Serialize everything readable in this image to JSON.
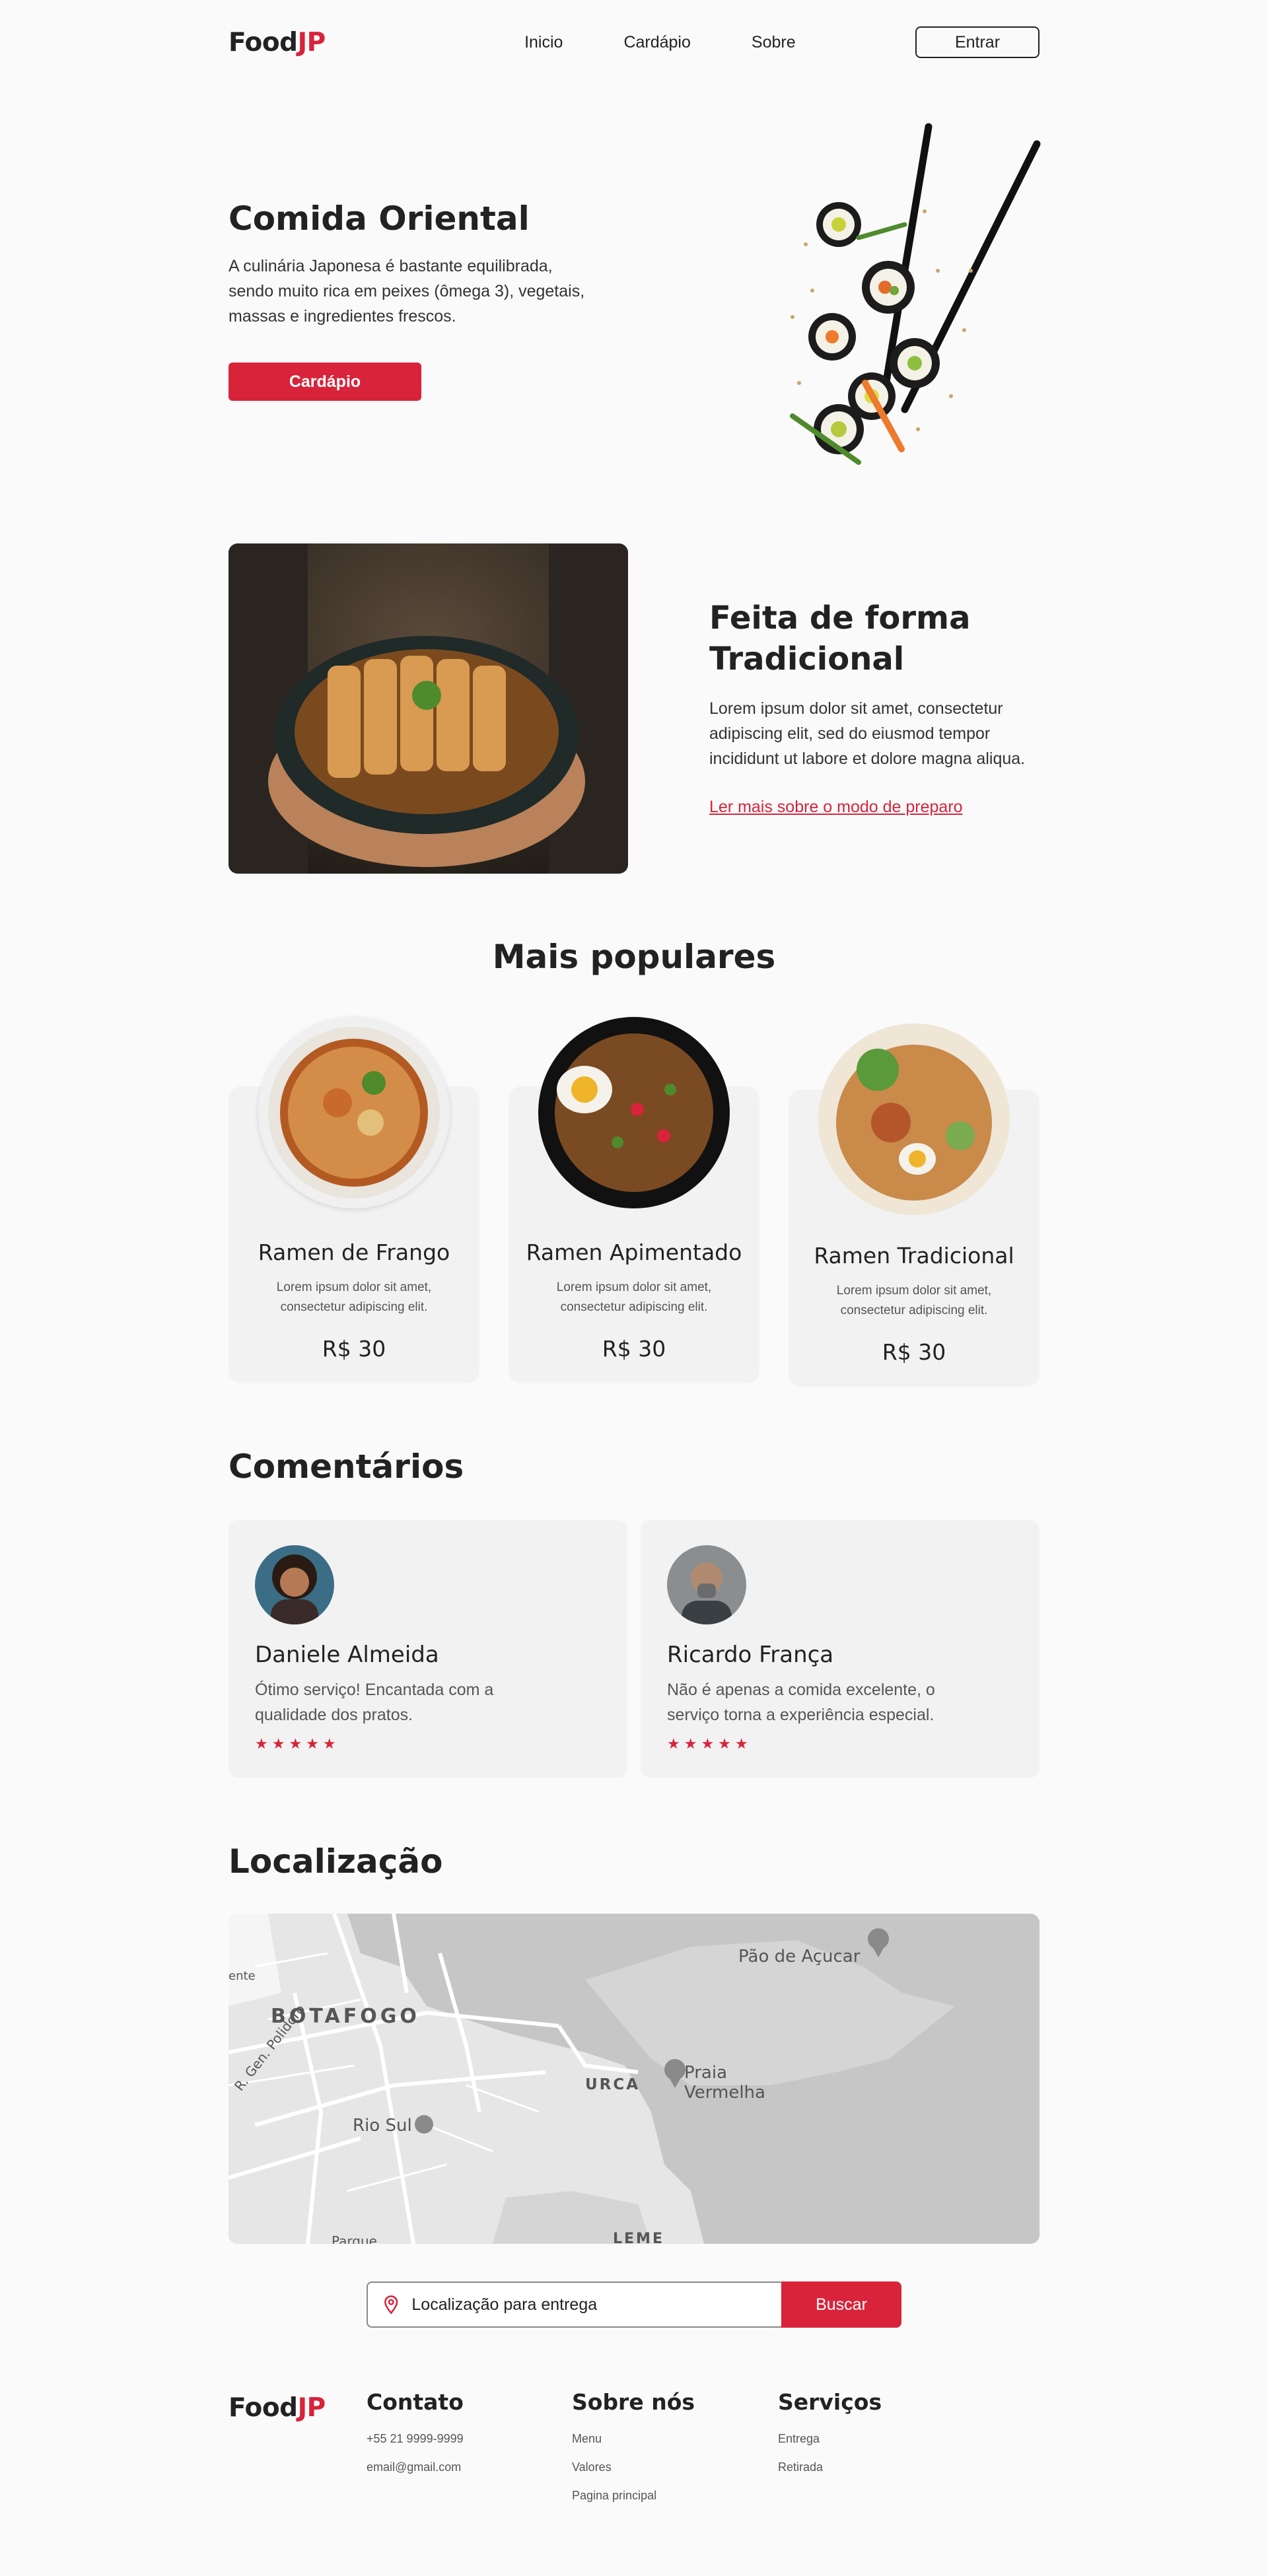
{
  "header": {
    "logo": {
      "part1": "Food",
      "part2": "JP"
    },
    "nav": [
      {
        "label": "Inicio"
      },
      {
        "label": "Cardápio"
      },
      {
        "label": "Sobre"
      }
    ],
    "login_label": "Entrar"
  },
  "hero": {
    "title": "Comida Oriental",
    "text": "A culinária Japonesa é bastante equilibrada, sendo muito rica em peixes (ômega 3), vegetais, massas e ingredientes frescos.",
    "button_label": "Cardápio"
  },
  "feature": {
    "title": "Feita de forma Tradicional",
    "text": "Lorem ipsum dolor sit amet, consectetur adipiscing elit, sed do eiusmod tempor incididunt ut labore et dolore magna aliqua.",
    "link": "Ler mais sobre o modo de preparo"
  },
  "popular": {
    "title": "Mais populares",
    "items": [
      {
        "name": "Ramen de Frango",
        "desc": "Lorem ipsum dolor sit amet, consectetur adipiscing elit.",
        "price": "R$ 30"
      },
      {
        "name": "Ramen Apimentado",
        "desc": "Lorem ipsum dolor sit amet, consectetur adipiscing elit.",
        "price": "R$ 30"
      },
      {
        "name": "Ramen Tradicional",
        "desc": "Lorem ipsum dolor sit amet, consectetur adipiscing elit.",
        "price": "R$ 30"
      }
    ]
  },
  "comments": {
    "title": "Comentários",
    "items": [
      {
        "name": "Daniele Almeida",
        "text": "Ótimo serviço! Encantada com a qualidade dos pratos.",
        "stars": "★★★★★"
      },
      {
        "name": "Ricardo França",
        "text": "Não é apenas a comida excelente, o serviço torna a experiência especial.",
        "stars": "★★★★★"
      }
    ]
  },
  "location": {
    "title": "Localização",
    "map_labels": {
      "botafogo": "BOTAFOGO",
      "urca": "URCA",
      "pao": "Pão de Açucar",
      "praia1": "Praia",
      "praia2": "Vermelha",
      "riosul": "Rio Sul",
      "gen": "R. Gen. Polidoro",
      "ente": "ente",
      "leme": "LEME",
      "parque": "Parque"
    },
    "search_placeholder": "Localização para entrega",
    "search_button": "Buscar"
  },
  "footer": {
    "logo": {
      "part1": "Food",
      "part2": "JP"
    },
    "contact": {
      "title": "Contato",
      "items": [
        "+55 21 9999-9999",
        "email@gmail.com"
      ]
    },
    "about": {
      "title": "Sobre nós",
      "items": [
        "Menu",
        "Valores",
        "Pagina principal"
      ]
    },
    "services": {
      "title": "Serviços",
      "items": [
        "Entrega",
        "Retirada"
      ]
    }
  },
  "colors": {
    "accent": "#d8233a",
    "text": "#222222",
    "card": "#f2f2f2",
    "background": "#fafafa"
  }
}
